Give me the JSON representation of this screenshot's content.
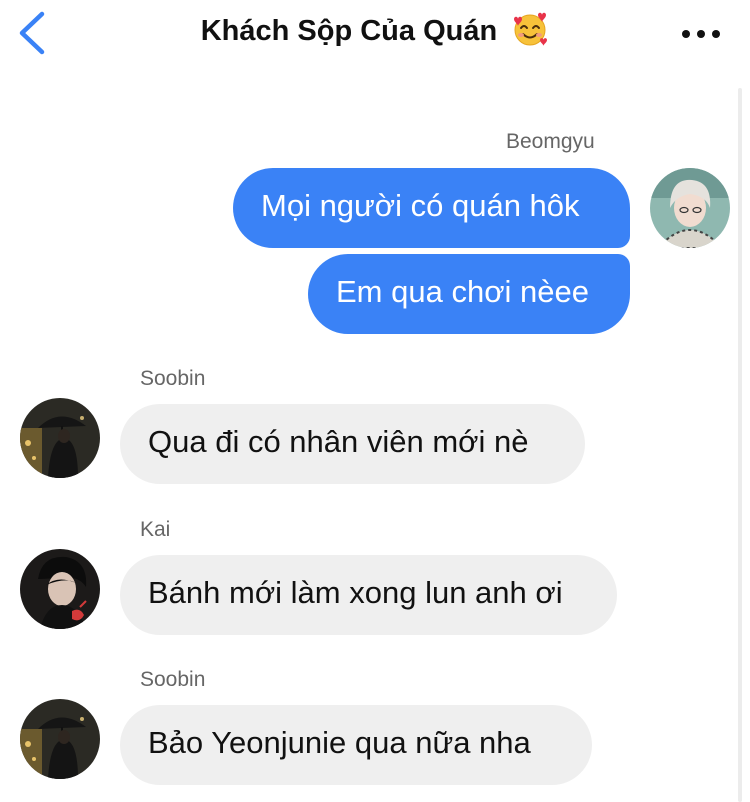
{
  "header": {
    "title": "Khách Sộp Của Quán",
    "back_icon": "chevron-left-icon",
    "more_icon": "more-horizontal-icon",
    "accent_color": "#3a82f6"
  },
  "messages": [
    {
      "sender": "Beomgyu",
      "direction": "outgoing",
      "texts": [
        "Mọi người có quán hôk",
        "Em qua chơi nèee"
      ],
      "avatar": "beomgyu-avatar"
    },
    {
      "sender": "Soobin",
      "direction": "incoming",
      "texts": [
        "Qua đi có nhân viên mới nè"
      ],
      "avatar": "soobin-avatar"
    },
    {
      "sender": "Kai",
      "direction": "incoming",
      "texts": [
        "Bánh mới làm xong lun anh ơi"
      ],
      "avatar": "kai-avatar"
    },
    {
      "sender": "Soobin",
      "direction": "incoming",
      "texts": [
        "Bảo Yeonjunie qua nữa nha"
      ],
      "avatar": "soobin-avatar"
    }
  ]
}
